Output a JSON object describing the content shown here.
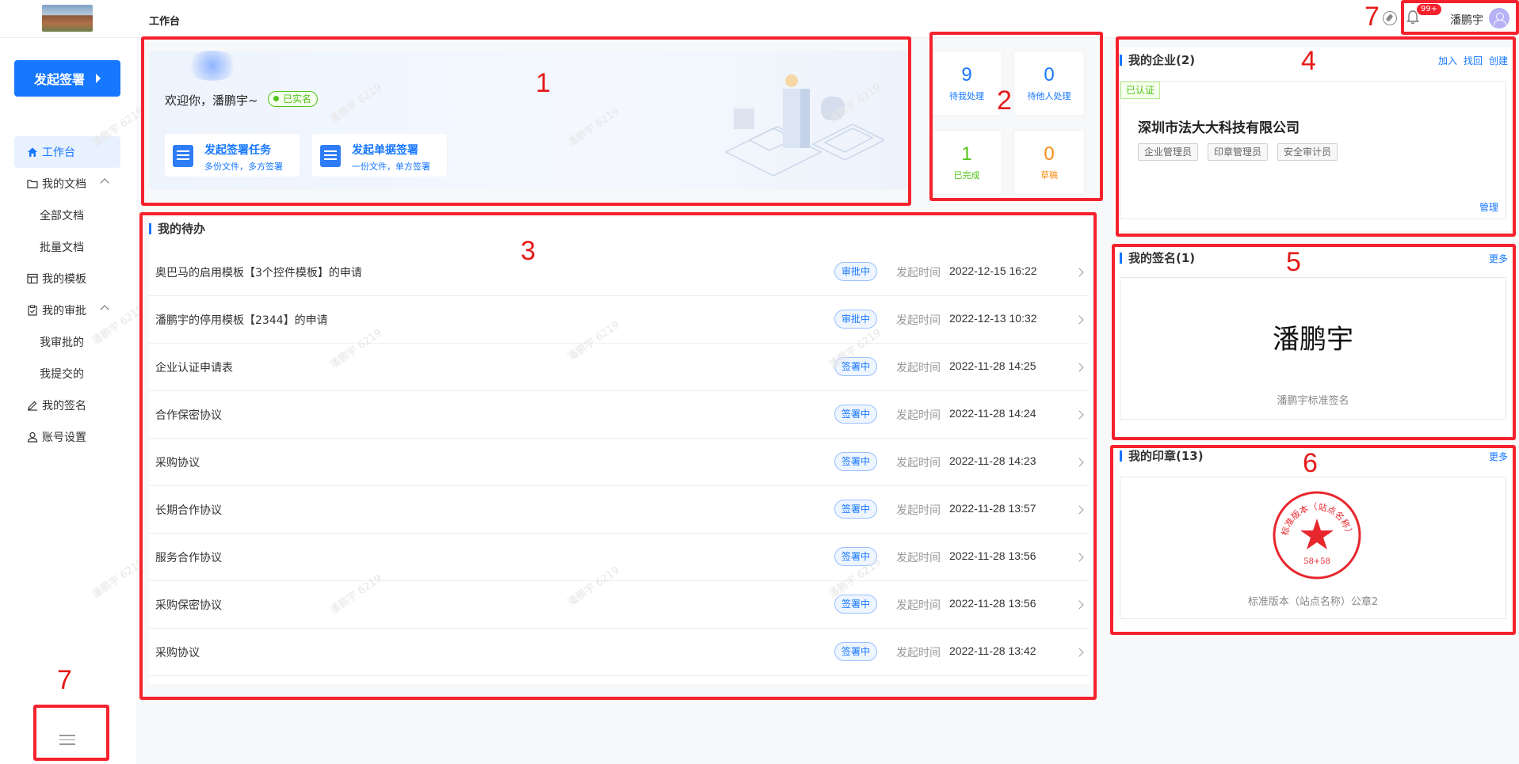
{
  "header": {
    "page_title": "工作台",
    "notification_badge": "99+",
    "user_name": "潘鹏宇"
  },
  "sidebar": {
    "start_button": "发起签署",
    "items": [
      {
        "label": "工作台",
        "icon": "home-icon",
        "active": true
      },
      {
        "label": "我的文档",
        "icon": "folder-icon",
        "expandable": true
      },
      {
        "label": "全部文档",
        "sub": true
      },
      {
        "label": "批量文档",
        "sub": true
      },
      {
        "label": "我的模板",
        "icon": "template-icon"
      },
      {
        "label": "我的审批",
        "icon": "clipboard-icon",
        "expandable": true
      },
      {
        "label": "我审批的",
        "sub": true
      },
      {
        "label": "我提交的",
        "sub": true
      },
      {
        "label": "我的签名",
        "icon": "pen-icon"
      },
      {
        "label": "账号设置",
        "icon": "user-icon"
      }
    ]
  },
  "welcome": {
    "greeting": "欢迎你，潘鹏宇~",
    "verified": "已实名",
    "actions": [
      {
        "title": "发起签署任务",
        "subtitle": "多份文件，多方签署"
      },
      {
        "title": "发起单据签署",
        "subtitle": "一份文件，单方签署"
      }
    ]
  },
  "stats": [
    {
      "num": "9",
      "label": "待我处理",
      "color": "#1677ff"
    },
    {
      "num": "0",
      "label": "待他人处理",
      "color": "#1677ff"
    },
    {
      "num": "1",
      "label": "已完成",
      "color": "#52c41a"
    },
    {
      "num": "0",
      "label": "草稿",
      "color": "#fa8c16"
    }
  ],
  "todos": {
    "title": "我的待办",
    "time_label": "发起时间",
    "rows": [
      {
        "title": "奥巴马的启用模板【3个控件模板】的申请",
        "status": "审批中",
        "time": "2022-12-15 16:22"
      },
      {
        "title": "潘鹏宇的停用模板【2344】的申请",
        "status": "审批中",
        "time": "2022-12-13 10:32"
      },
      {
        "title": "企业认证申请表",
        "status": "签署中",
        "time": "2022-11-28 14:25"
      },
      {
        "title": "合作保密协议",
        "status": "签署中",
        "time": "2022-11-28 14:24"
      },
      {
        "title": "采购协议",
        "status": "签署中",
        "time": "2022-11-28 14:23"
      },
      {
        "title": "长期合作协议",
        "status": "签署中",
        "time": "2022-11-28 13:57"
      },
      {
        "title": "服务合作协议",
        "status": "签署中",
        "time": "2022-11-28 13:56"
      },
      {
        "title": "采购保密协议",
        "status": "签署中",
        "time": "2022-11-28 13:56"
      },
      {
        "title": "采购协议",
        "status": "签署中",
        "time": "2022-11-28 13:42"
      }
    ]
  },
  "enterprise": {
    "title": "我的企业(2)",
    "links": [
      "加入",
      "找回",
      "创建"
    ],
    "certified": "已认证",
    "name": "深圳市法大大科技有限公司",
    "roles": [
      "企业管理员",
      "印章管理员",
      "安全审计员"
    ],
    "manage": "管理"
  },
  "signature": {
    "title": "我的签名(1)",
    "more": "更多",
    "name": "潘鹏宇",
    "caption": "潘鹏宇标准签名"
  },
  "seal": {
    "title": "我的印章(13)",
    "more": "更多",
    "ring_text": "标准版本（站点名称）",
    "code": "58+58",
    "caption": "标准版本（站点名称）公章2"
  },
  "annotations": [
    "1",
    "2",
    "3",
    "4",
    "5",
    "6",
    "7",
    "7"
  ],
  "watermark": "潘鹏宇 6219"
}
